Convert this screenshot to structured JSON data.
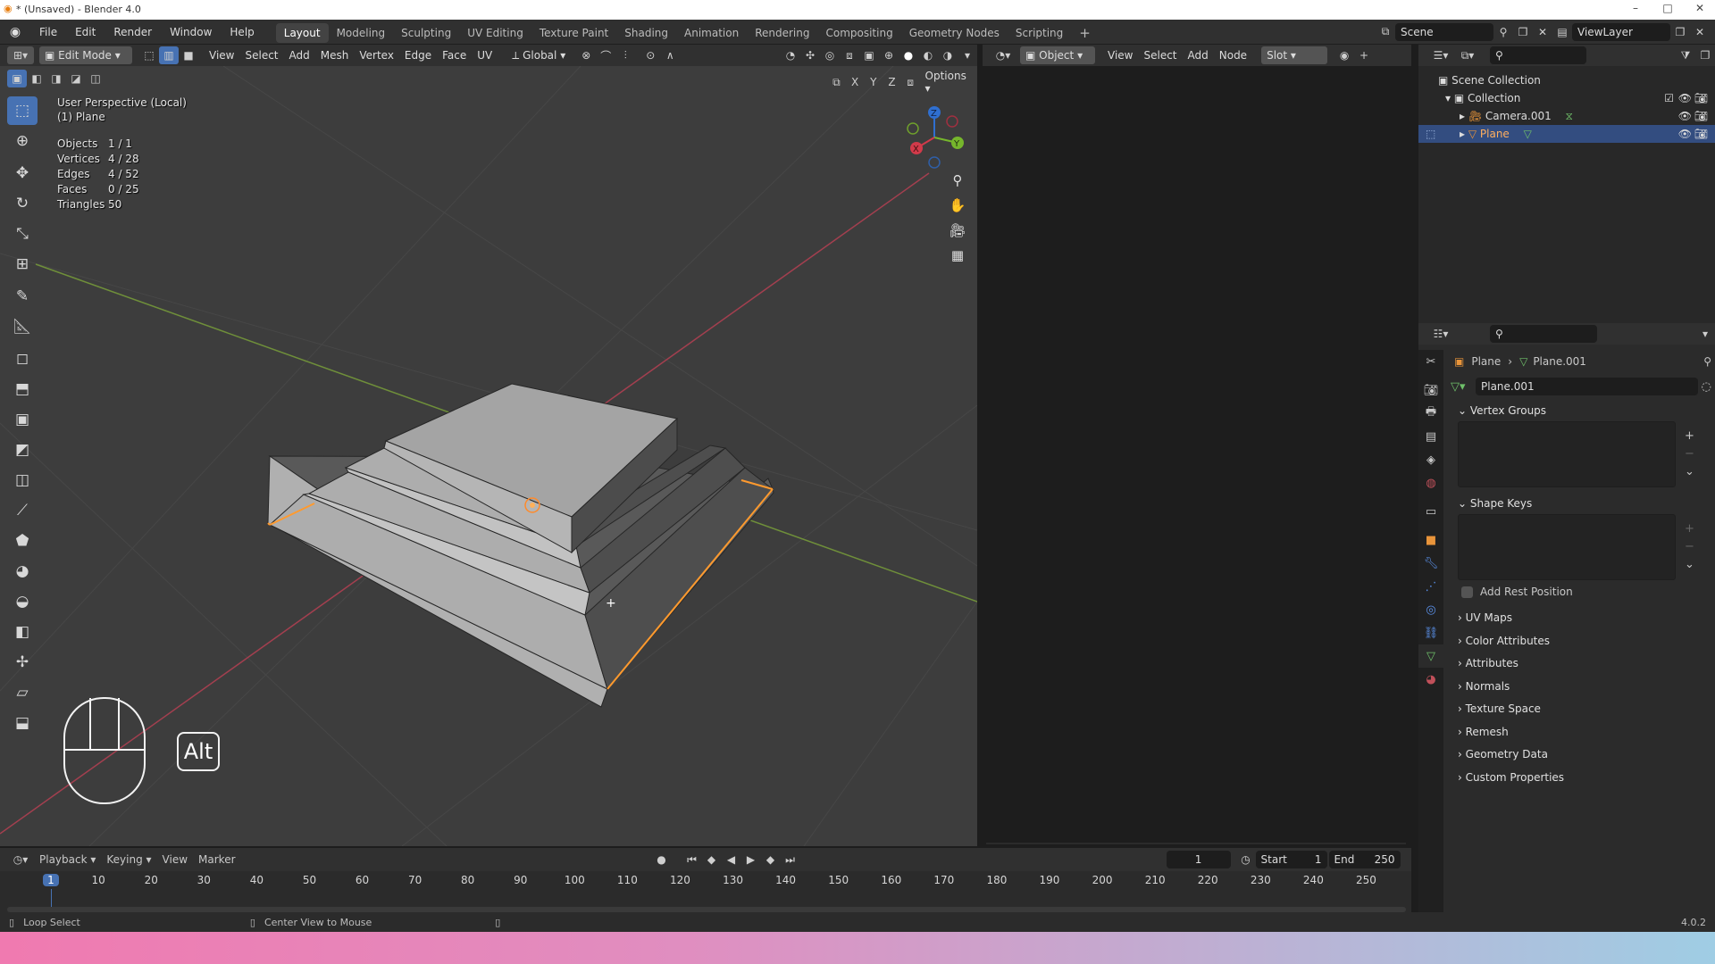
{
  "window": {
    "title": "* (Unsaved) - Blender 4.0",
    "controls": [
      "–",
      "□",
      "✕"
    ]
  },
  "menu": [
    "File",
    "Edit",
    "Render",
    "Window",
    "Help"
  ],
  "workspaces": [
    "Layout",
    "Modeling",
    "Sculpting",
    "UV Editing",
    "Texture Paint",
    "Shading",
    "Animation",
    "Rendering",
    "Compositing",
    "Geometry Nodes",
    "Scripting"
  ],
  "active_workspace": "Layout",
  "scene": {
    "name": "Scene",
    "view_layer": "ViewLayer"
  },
  "viewport_header": {
    "mode": "Edit Mode",
    "menus": [
      "View",
      "Select",
      "Add",
      "Mesh",
      "Vertex",
      "Edge",
      "Face",
      "UV"
    ],
    "orientation": "Global",
    "axes": [
      "X",
      "Y",
      "Z"
    ],
    "options": "Options"
  },
  "viewport": {
    "view_name": "User Perspective (Local)",
    "object_name": "(1) Plane",
    "stats": [
      {
        "label": "Objects",
        "value": "1 / 1"
      },
      {
        "label": "Vertices",
        "value": "4 / 28"
      },
      {
        "label": "Edges",
        "value": "4 / 52"
      },
      {
        "label": "Faces",
        "value": "0 / 25"
      },
      {
        "label": "Triangles",
        "value": "50"
      }
    ],
    "key_hint": "Alt",
    "gizmo_axes": {
      "z": "Z",
      "y": "Y",
      "x": "X"
    }
  },
  "node_editor_header": {
    "type": "Object",
    "menus": [
      "View",
      "Select",
      "Add",
      "Node"
    ],
    "slot": "Slot"
  },
  "outliner": {
    "root": "Scene Collection",
    "collection": "Collection",
    "items": [
      {
        "name": "Camera.001",
        "selected": false
      },
      {
        "name": "Plane",
        "selected": true
      }
    ]
  },
  "properties": {
    "breadcrumb_object": "Plane",
    "breadcrumb_data": "Plane.001",
    "data_name": "Plane.001",
    "vertex_groups": "Vertex Groups",
    "shape_keys": "Shape Keys",
    "add_rest_position": "Add Rest Position",
    "collapsed_panels": [
      "UV Maps",
      "Color Attributes",
      "Attributes",
      "Normals",
      "Texture Space",
      "Remesh",
      "Geometry Data",
      "Custom Properties"
    ]
  },
  "timeline": {
    "menus": [
      "Playback",
      "Keying",
      "View",
      "Marker"
    ],
    "current_frame": "1",
    "start_label": "Start",
    "start": "1",
    "end_label": "End",
    "end": "250",
    "ticks": [
      "1",
      "10",
      "20",
      "30",
      "40",
      "50",
      "60",
      "70",
      "80",
      "90",
      "100",
      "110",
      "120",
      "130",
      "140",
      "150",
      "160",
      "170",
      "180",
      "190",
      "200",
      "210",
      "220",
      "230",
      "240",
      "250"
    ]
  },
  "statusbar": {
    "left": "Loop Select",
    "middle": "Center View to Mouse",
    "version": "4.0.2"
  },
  "colors": {
    "accent": "#4772b3",
    "selection_edge": "#ff9a2e",
    "header_bg": "#303030",
    "viewport_bg": "#3d3d3d"
  }
}
